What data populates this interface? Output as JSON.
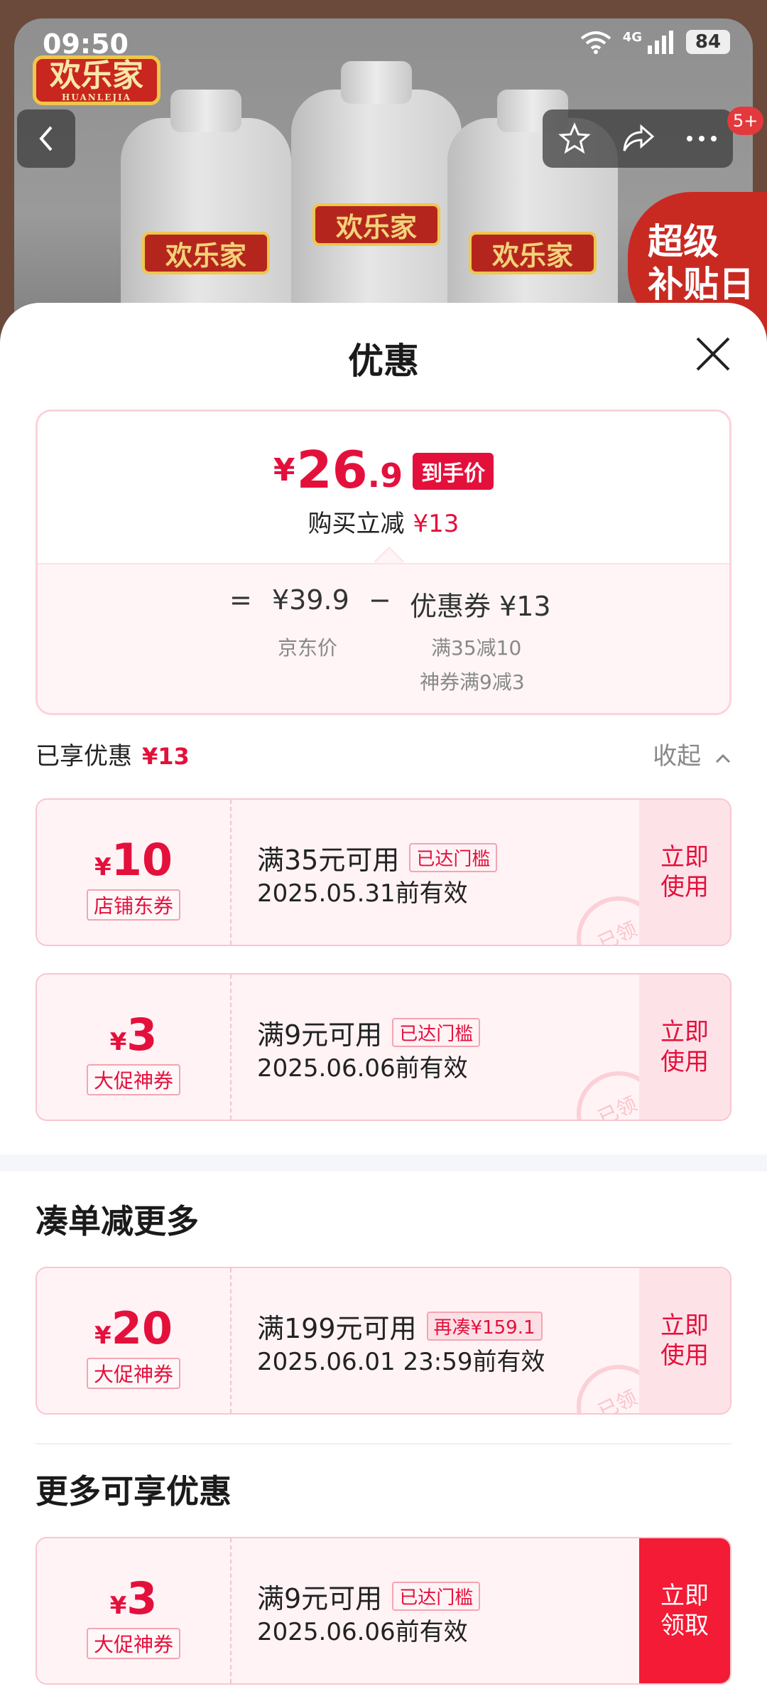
{
  "status_bar": {
    "time": "09:50",
    "network": "4G",
    "battery": "84"
  },
  "background": {
    "brand": "欢乐家",
    "brand_en": "HUANLEJIA",
    "promo_badge_line1": "超级",
    "promo_badge_line2": "补贴日",
    "cart_badge": "5+"
  },
  "sheet": {
    "title": "优惠",
    "price_card": {
      "final_yen": "¥",
      "final_int": "26",
      "final_dec": ".9",
      "final_tag": "到手价",
      "save_label": "购买立减",
      "save_amount": "¥13",
      "equals": "=",
      "jd_price": "¥39.9",
      "minus": "−",
      "coupon_label": "优惠券 ¥13",
      "jd_price_label": "京东价",
      "coupon_detail_1": "满35减10",
      "coupon_detail_2": "神券满9减3"
    },
    "enjoyed": {
      "label": "已享优惠",
      "amount": "¥13",
      "collapse": "收起"
    },
    "coupons_enjoyed": [
      {
        "yen": "¥",
        "value": "10",
        "type": "店铺东券",
        "condition": "满35元可用",
        "tag": "已达门槛",
        "expire": "2025.05.31前有效",
        "action": "立即使用",
        "stamp": "已领"
      },
      {
        "yen": "¥",
        "value": "3",
        "type": "大促神券",
        "condition": "满9元可用",
        "tag": "已达门槛",
        "expire": "2025.06.06前有效",
        "action": "立即使用",
        "stamp": "已领"
      }
    ],
    "section_more_orders": "凑单减更多",
    "coupons_more": [
      {
        "yen": "¥",
        "value": "20",
        "type": "大促神券",
        "condition": "满199元可用",
        "tag": "再凑¥159.1",
        "expire": "2025.06.01 23:59前有效",
        "action": "立即使用",
        "stamp": "已领"
      }
    ],
    "section_more_available": "更多可享优惠",
    "coupons_available": [
      {
        "yen": "¥",
        "value": "3",
        "type": "大促神券",
        "condition": "满9元可用",
        "tag": "已达门槛",
        "expire": "2025.06.06前有效",
        "action": "立即领取"
      }
    ]
  }
}
